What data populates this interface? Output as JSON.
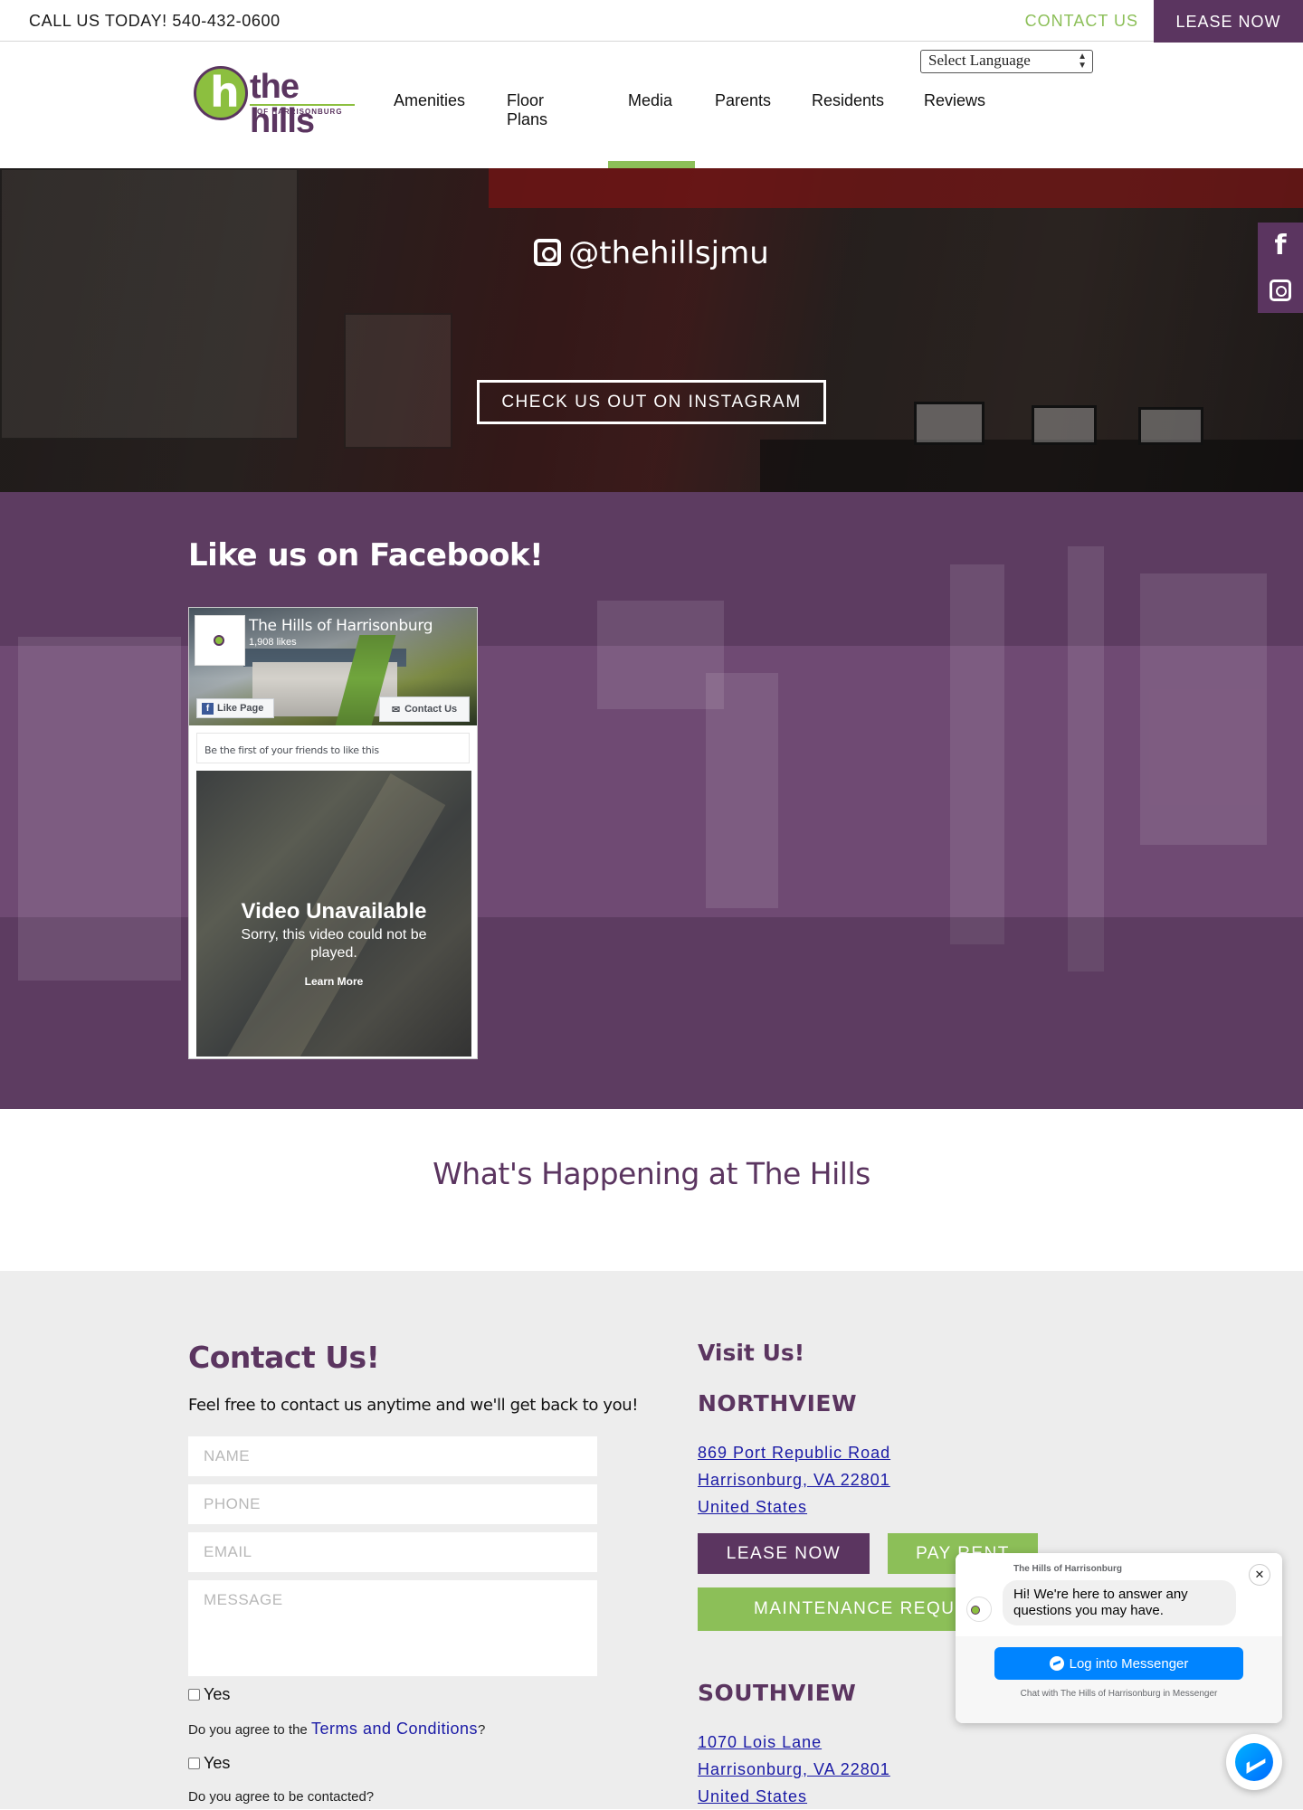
{
  "topbar": {
    "phone": "CALL US TODAY! 540-432-0600",
    "contact_label": "CONTACT US",
    "lease_label": "LEASE NOW"
  },
  "header": {
    "language_select": "Select Language",
    "logo": {
      "primary": "the hills",
      "secondary": "OF HARRISONBURG"
    },
    "nav": [
      {
        "label": "Amenities"
      },
      {
        "label": "Floor Plans"
      },
      {
        "label": "Media",
        "active": true
      },
      {
        "label": "Parents"
      },
      {
        "label": "Residents"
      },
      {
        "label": "Reviews"
      }
    ]
  },
  "instagram": {
    "handle": "@thehillsjmu",
    "button_label": "CHECK US OUT ON INSTAGRAM"
  },
  "social_tabs": {
    "facebook_glyph": "f"
  },
  "facebook": {
    "title": "Like us on Facebook!",
    "widget": {
      "page_name": "The Hills of Harrisonburg",
      "likes": "1,908 likes",
      "like_button": "Like Page",
      "contact_button": "Contact Us",
      "friends_text": "Be the first of your friends to like this",
      "video_title": "Video Unavailable",
      "video_message": "Sorry, this video could not be played.",
      "video_link": "Learn More"
    }
  },
  "happening": {
    "title": "What's Happening at The Hills"
  },
  "contact_form": {
    "title": "Contact Us!",
    "subtitle": "Feel free to contact us anytime and we'll get back to you!",
    "placeholders": {
      "name": "NAME",
      "phone": "PHONE",
      "email": "EMAIL",
      "message": "MESSAGE"
    },
    "checkbox_label_1": "Yes",
    "agree_terms_prefix": "Do you agree to the ",
    "terms_link": "Terms and Conditions",
    "agree_terms_suffix": "?",
    "checkbox_label_2": "Yes",
    "agree_contact": "Do you agree to be contacted?"
  },
  "visit": {
    "title": "Visit Us!",
    "northview": {
      "heading": "NORTHVIEW",
      "address": [
        "869 Port Republic Road",
        "Harrisonburg, VA 22801",
        "United States"
      ]
    },
    "buttons": {
      "lease": "LEASE NOW",
      "pay": "PAY RENT",
      "maintenance": "MAINTENANCE REQUEST"
    },
    "southview": {
      "heading": "SOUTHVIEW",
      "address": [
        "1070 Lois Lane",
        "Harrisonburg, VA 22801",
        "United States"
      ]
    }
  },
  "messenger": {
    "page_name": "The Hills of Harrisonburg",
    "greeting": "Hi! We're here to answer any questions you may have.",
    "close_glyph": "✕",
    "login_label": "Log into Messenger",
    "chat_with": "Chat with The Hills of Harrisonburg in Messenger"
  },
  "colors": {
    "brand_purple": "#5b3560",
    "brand_green": "#8cbf58",
    "link_blue": "#1a1aa6"
  }
}
